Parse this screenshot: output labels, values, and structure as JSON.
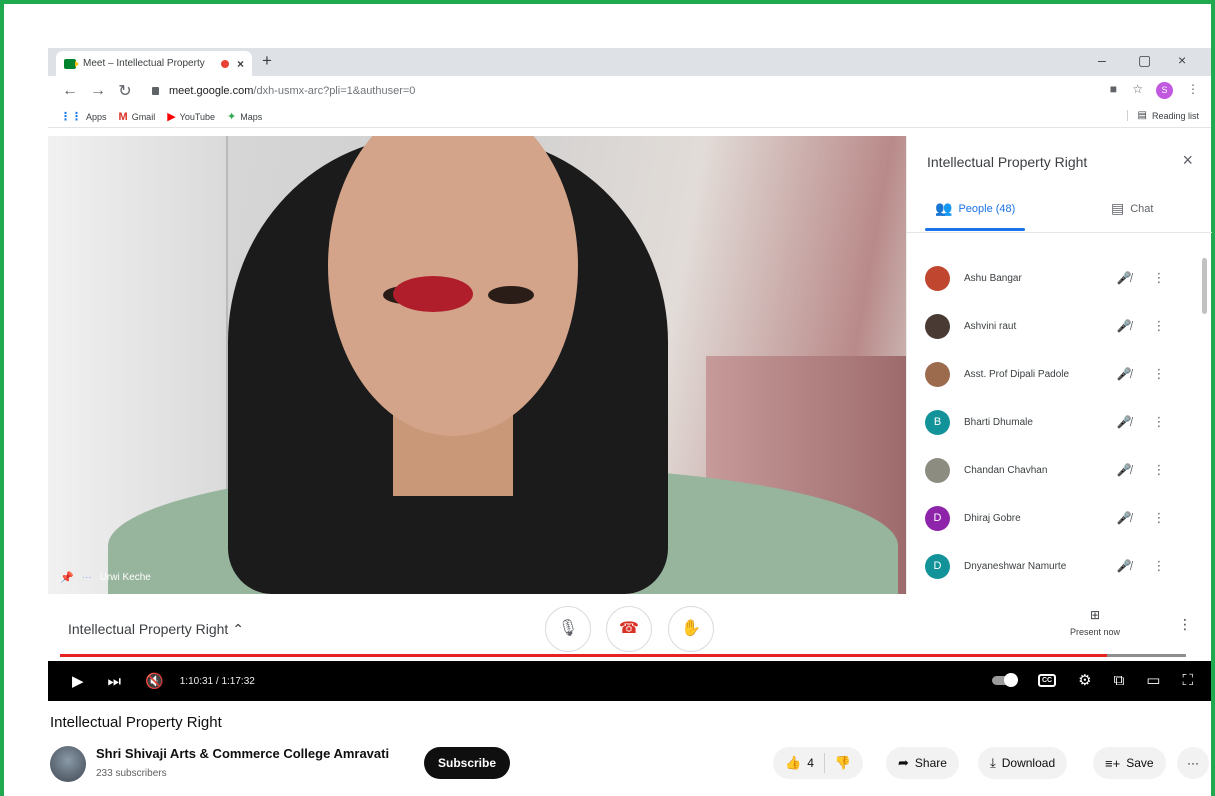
{
  "browser": {
    "tab_title": "Meet – Intellectual Property",
    "tab_close": "×",
    "new_tab": "+",
    "win_min": "–",
    "win_max": "▢",
    "win_close": "×",
    "url_host": "meet.google.com",
    "url_path": "/dxh-usmx-arc?pli=1&authuser=0",
    "profile_letter": "S",
    "bookmarks": [
      {
        "label": "Apps",
        "icon": "apps-grid-icon"
      },
      {
        "label": "Gmail",
        "icon": "gmail-icon"
      },
      {
        "label": "YouTube",
        "icon": "youtube-icon"
      },
      {
        "label": "Maps",
        "icon": "maps-icon"
      }
    ],
    "reading_list": "Reading list"
  },
  "meet": {
    "speaker_name": "Urwi Keche",
    "meeting_title": "Intellectual Property Right",
    "present_label": "Present now",
    "panel": {
      "title": "Intellectual Property Right",
      "tab_people": "People (48)",
      "tab_chat": "Chat",
      "participants": [
        {
          "name": "Ashu Bangar",
          "initial": "",
          "color": "#c0462f"
        },
        {
          "name": "Ashvini raut",
          "initial": "",
          "color": "#4a3a34"
        },
        {
          "name": "Asst. Prof Dipali Padole",
          "initial": "",
          "color": "#9c6b4e"
        },
        {
          "name": "Bharti Dhumale",
          "initial": "B",
          "color": "#12939a"
        },
        {
          "name": "Chandan Chavhan",
          "initial": "",
          "color": "#8c8c80"
        },
        {
          "name": "Dhiraj Gobre",
          "initial": "D",
          "color": "#8e24aa"
        },
        {
          "name": "Dnyaneshwar Namurte",
          "initial": "D",
          "color": "#12939a"
        }
      ]
    }
  },
  "player": {
    "time": "1:10:31 / 1:17:32",
    "progress": 0.93
  },
  "video": {
    "title": "Intellectual Property Right",
    "channel": "Shri Shivaji Arts & Commerce College Amravati",
    "subscribers": "233 subscribers",
    "subscribe_label": "Subscribe",
    "likes": "4",
    "share_label": "Share",
    "download_label": "Download",
    "save_label": "Save",
    "more": "···"
  },
  "colors": {
    "frame_border": "#1faa4f",
    "progress_played": "#e52420",
    "meet_blue": "#1a73e8"
  }
}
